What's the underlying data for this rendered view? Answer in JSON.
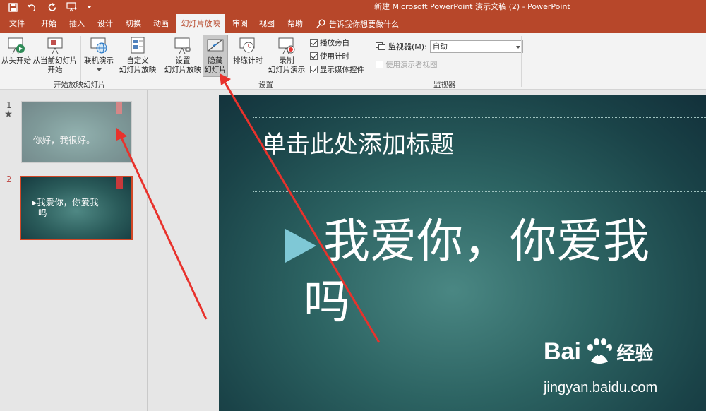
{
  "window": {
    "title": "新建 Microsoft PowerPoint 演示文稿 (2)  -  PowerPoint"
  },
  "tabs": [
    {
      "label": "文件"
    },
    {
      "label": "开始"
    },
    {
      "label": "插入"
    },
    {
      "label": "设计"
    },
    {
      "label": "切换"
    },
    {
      "label": "动画"
    },
    {
      "label": "幻灯片放映"
    },
    {
      "label": "审阅"
    },
    {
      "label": "视图"
    },
    {
      "label": "帮助"
    }
  ],
  "tell_me": {
    "placeholder": "告诉我你想要做什么"
  },
  "ribbon": {
    "from_beginning": "从头开始",
    "from_current_1": "从当前幻灯片",
    "from_current_2": "开始",
    "online": "联机演示",
    "custom_1": "自定义",
    "custom_2": "幻灯片放映",
    "group_start": "开始放映幻灯片",
    "setup_1": "设置",
    "setup_2": "幻灯片放映",
    "hide_1": "隐藏",
    "hide_2": "幻灯片",
    "rehearse": "排练计时",
    "record_1": "录制",
    "record_2": "幻灯片演示",
    "narration": "播放旁白",
    "timings": "使用计时",
    "media": "显示媒体控件",
    "group_setup": "设置",
    "monitor_label": "监视器(M):",
    "monitor_value": "自动",
    "presenter": "使用演示者视图",
    "group_monitor": "监视器"
  },
  "thumbnails": [
    {
      "num": "1",
      "text": "你好，我很好。",
      "hidden": true
    },
    {
      "num": "2",
      "line1": "▸我爱你，你爱我",
      "line2": "吗",
      "hidden": false
    }
  ],
  "slide": {
    "title_placeholder": "单击此处添加标题",
    "body_line1": "我爱你，你爱我",
    "body_line2": "吗"
  },
  "watermark": {
    "logo_text": "Bai",
    "logo_du": "du",
    "logo_cn": "经验",
    "url": "jingyan.baidu.com"
  },
  "colors": {
    "accent": "#b7472a",
    "arrow": "#e8322c"
  }
}
